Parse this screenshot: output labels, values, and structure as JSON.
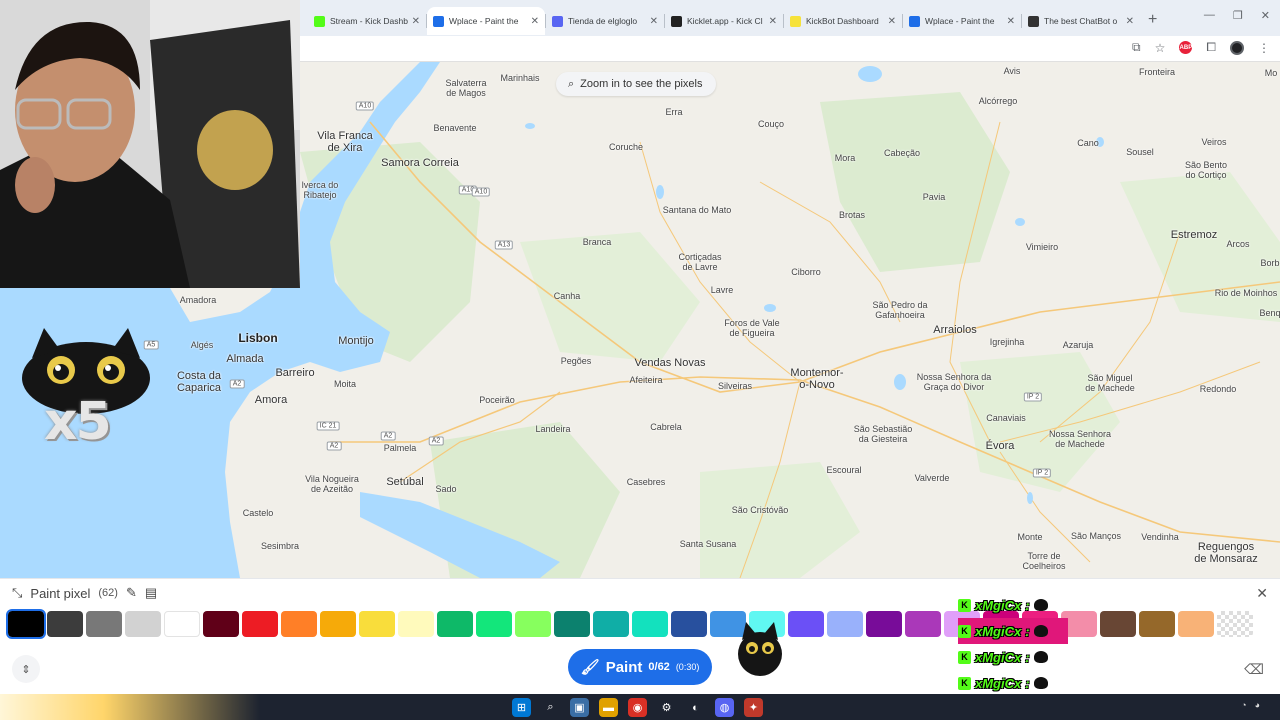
{
  "tabs": [
    {
      "label": "Stream - Kick Dashb",
      "icon": "kick-icon",
      "color": "#53fc18",
      "active": false
    },
    {
      "label": "Wplace - Paint the",
      "icon": "globe-icon",
      "color": "#1e6ee8",
      "active": true
    },
    {
      "label": "Tienda de elgloglo",
      "icon": "discord-icon",
      "color": "#5865f2",
      "active": false
    },
    {
      "label": "Kicklet.app - Kick Cl",
      "icon": "kicklet-icon",
      "color": "#222222",
      "active": false
    },
    {
      "label": "KickBot Dashboard",
      "icon": "kickbot-icon",
      "color": "#f6e23a",
      "active": false
    },
    {
      "label": "Wplace - Paint the",
      "icon": "globe-icon",
      "color": "#1e6ee8",
      "active": false
    },
    {
      "label": "The best ChatBot o",
      "icon": "chatbot-icon",
      "color": "#333333",
      "active": false
    }
  ],
  "map": {
    "zoom_hint": "Zoom in to see the pixels",
    "places": [
      {
        "name": "Salvaterra de Magos",
        "lines": [
          "Salvaterra",
          "de Magos"
        ],
        "size": "s"
      },
      {
        "name": "Marinhais",
        "size": "s"
      },
      {
        "name": "Erra",
        "size": "s"
      },
      {
        "name": "Couço",
        "size": "s"
      },
      {
        "name": "Avis",
        "size": "s"
      },
      {
        "name": "Fronteira",
        "size": "s"
      },
      {
        "name": "Alcórrego",
        "size": "s"
      },
      {
        "name": "Benavente",
        "size": "s"
      },
      {
        "name": "Vila Franca de Xira",
        "lines": [
          "Vila Franca",
          "de Xira"
        ],
        "size": "m"
      },
      {
        "name": "Samora Correia",
        "size": "m"
      },
      {
        "name": "Coruche",
        "size": "s"
      },
      {
        "name": "Mora",
        "size": "s"
      },
      {
        "name": "Cabeção",
        "size": "s"
      },
      {
        "name": "Cano",
        "size": "s"
      },
      {
        "name": "Sousel",
        "size": "s"
      },
      {
        "name": "Veiros",
        "size": "s"
      },
      {
        "name": "Alverca do Ribatejo",
        "lines": [
          "lverca do",
          "Ribatejo"
        ],
        "size": "s"
      },
      {
        "name": "São Bento do Cortiço",
        "lines": [
          "São Bento",
          "do Cortiço"
        ],
        "size": "s"
      },
      {
        "name": "Santana do Mato",
        "size": "s"
      },
      {
        "name": "Brotas",
        "size": "s"
      },
      {
        "name": "Pavia",
        "size": "s"
      },
      {
        "name": "Estremoz",
        "size": "m"
      },
      {
        "name": "Arcos",
        "size": "s"
      },
      {
        "name": "Branca",
        "size": "s"
      },
      {
        "name": "Cortiçadas de Lavre",
        "lines": [
          "Cortiçadas",
          "de Lavre"
        ],
        "size": "s"
      },
      {
        "name": "Vimieiro",
        "size": "s"
      },
      {
        "name": "Ciborro",
        "size": "s"
      },
      {
        "name": "Amadora",
        "size": "s"
      },
      {
        "name": "Canha",
        "size": "s"
      },
      {
        "name": "Lavre",
        "size": "s"
      },
      {
        "name": "São Pedro da Gafanhoeira",
        "lines": [
          "São Pedro da",
          "Gafanhoeira"
        ],
        "size": "s"
      },
      {
        "name": "Rio de Moinhos",
        "size": "s"
      },
      {
        "name": "Foros de Vale de Figueira",
        "lines": [
          "Foros de Vale",
          "de Figueira"
        ],
        "size": "s"
      },
      {
        "name": "Arraiolos",
        "size": "m"
      },
      {
        "name": "Lisbon",
        "size": "l"
      },
      {
        "name": "Montijo",
        "size": "m"
      },
      {
        "name": "Algés",
        "size": "s"
      },
      {
        "name": "Igrejinha",
        "size": "s"
      },
      {
        "name": "Azaruja",
        "size": "s"
      },
      {
        "name": "Almada",
        "size": "m"
      },
      {
        "name": "Pegões",
        "size": "s"
      },
      {
        "name": "Vendas Novas",
        "size": "m"
      },
      {
        "name": "Montemor-o-Novo",
        "lines": [
          "Montemor-",
          "o-Novo"
        ],
        "size": "m"
      },
      {
        "name": "São Miguel de Machede",
        "lines": [
          "São Miguel",
          "de Machede"
        ],
        "size": "s"
      },
      {
        "name": "Barreiro",
        "size": "m"
      },
      {
        "name": "Costa da Caparica",
        "lines": [
          "Costa da",
          "Caparica"
        ],
        "size": "m"
      },
      {
        "name": "Nossa Senhora da Graça do Divor",
        "lines": [
          "Nossa Senhora da",
          "Graça do Divor"
        ],
        "size": "s"
      },
      {
        "name": "Moita",
        "size": "s"
      },
      {
        "name": "Afeiteira",
        "size": "s"
      },
      {
        "name": "Silveiras",
        "size": "s"
      },
      {
        "name": "Redondo",
        "size": "s"
      },
      {
        "name": "Amora",
        "size": "m"
      },
      {
        "name": "Poceirão",
        "size": "s"
      },
      {
        "name": "Canaviais",
        "size": "s"
      },
      {
        "name": "Landeira",
        "size": "s"
      },
      {
        "name": "Cabrela",
        "size": "s"
      },
      {
        "name": "São Sebastião da Giesteira",
        "lines": [
          "São Sebastião",
          "da Giesteira"
        ],
        "size": "s"
      },
      {
        "name": "Nossa Senhora de Machede",
        "lines": [
          "Nossa Senhora",
          "de Machede"
        ],
        "size": "s"
      },
      {
        "name": "Évora",
        "size": "m"
      },
      {
        "name": "Palmela",
        "size": "s"
      },
      {
        "name": "Escoural",
        "size": "s"
      },
      {
        "name": "Valverde",
        "size": "s"
      },
      {
        "name": "Vila Nogueira de Azeitão",
        "lines": [
          "Vila Nogueira",
          "de Azeitão"
        ],
        "size": "s"
      },
      {
        "name": "Setúbal",
        "size": "m"
      },
      {
        "name": "Sado",
        "size": "s"
      },
      {
        "name": "Casebres",
        "size": "s"
      },
      {
        "name": "Monte do Trigo",
        "lines": [
          "Monte"
        ],
        "size": "s"
      },
      {
        "name": "Castelo",
        "size": "s"
      },
      {
        "name": "São Cristóvão",
        "size": "s"
      },
      {
        "name": "São Manços",
        "size": "s"
      },
      {
        "name": "Vendinha",
        "size": "s"
      },
      {
        "name": "Reguengos de Monsaraz",
        "lines": [
          "Reguengos",
          "de Monsaraz"
        ],
        "size": "m"
      },
      {
        "name": "Sesimbra",
        "size": "s"
      },
      {
        "name": "Santa Susana",
        "size": "s"
      },
      {
        "name": "Torre de Coelheiros",
        "lines": [
          "Torre de",
          "Coelheiros"
        ],
        "size": "s"
      },
      {
        "name": "Mo",
        "size": "s"
      },
      {
        "name": "Borba",
        "lines": [
          "Borb"
        ],
        "size": "s"
      },
      {
        "name": "Benquerenças",
        "lines": [
          "Benq"
        ],
        "size": "s"
      }
    ],
    "shields": [
      "A10",
      "A10",
      "A10",
      "A13",
      "A2",
      "A2",
      "A2",
      "A2",
      "IC 21",
      "IP 2",
      "IP 2",
      "A5"
    ]
  },
  "sticker": {
    "multiplier": "x5"
  },
  "panel": {
    "title": "Paint pixel",
    "count": "(62)",
    "paint_label": "Paint",
    "paint_count": "0/62",
    "paint_timer": "(0:30)",
    "palette": [
      "#000000",
      "#3c3c3c",
      "#787878",
      "#d2d2d2",
      "#ffffff",
      "#600018",
      "#ed1c24",
      "#ff7f27",
      "#f6aa09",
      "#f9dd3b",
      "#fffabc",
      "#0eb968",
      "#13e67b",
      "#87ff5e",
      "#0c816e",
      "#10aea6",
      "#13e1be",
      "#28509e",
      "#4093e4",
      "#60f7f2",
      "#6b50f6",
      "#99b1fb",
      "#780c99",
      "#aa38b9",
      "#e09ff9",
      "#cb007a",
      "#ec1f80",
      "#f38da9",
      "#684634",
      "#95682a",
      "#f8b277",
      "transparent"
    ],
    "selected_index": 0
  },
  "chat": {
    "messages": [
      {
        "user": "xMgiCx",
        "sep": ":"
      },
      {
        "user": "xMgiCx",
        "sep": ":",
        "highlight": true
      },
      {
        "user": "xMgiCx",
        "sep": ":"
      },
      {
        "user": "xMgiCx",
        "sep": ":"
      },
      {
        "user": "xMgiCx",
        "sep": ":"
      }
    ],
    "accent": "#53fc18"
  },
  "colors": {
    "water": "#aadaff",
    "land": "#f1efe9",
    "green": "#dcebd0",
    "accent": "#1e6ee8"
  }
}
